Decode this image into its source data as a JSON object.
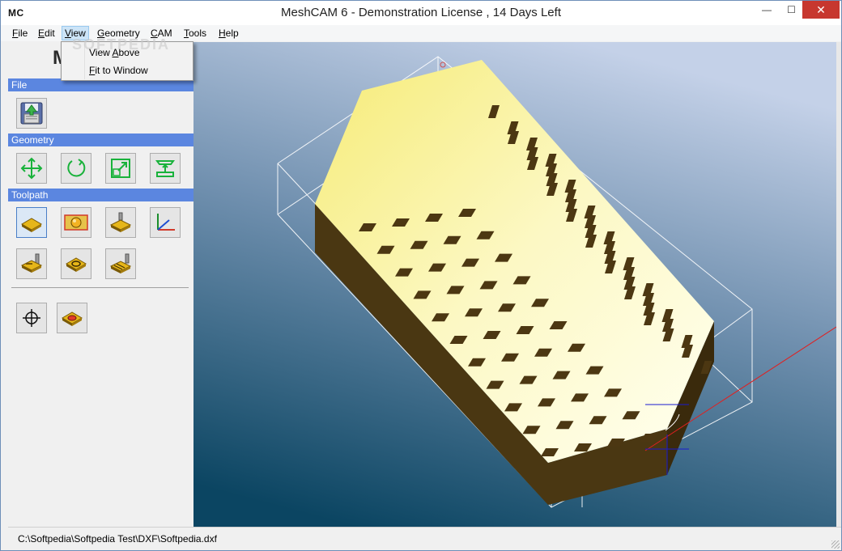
{
  "window": {
    "logo": "MC",
    "title": "MeshCAM 6 - Demonstration License  , 14 Days Left",
    "close_glyph": "✕",
    "min_glyph": "—",
    "max_glyph": "☐"
  },
  "menu": {
    "items": [
      {
        "id": "file",
        "label_u": "F",
        "label_rest": "ile"
      },
      {
        "id": "edit",
        "label_u": "E",
        "label_rest": "dit"
      },
      {
        "id": "view",
        "label_u": "V",
        "label_rest": "iew"
      },
      {
        "id": "geometry",
        "label_u": "G",
        "label_rest": "eometry"
      },
      {
        "id": "cam",
        "label_u": "C",
        "label_rest": "AM"
      },
      {
        "id": "tools",
        "label_u": "T",
        "label_rest": "ools"
      },
      {
        "id": "help",
        "label_u": "H",
        "label_rest": "elp"
      }
    ]
  },
  "view_menu": {
    "items": [
      {
        "pre": "View ",
        "u": "A",
        "post": "bove"
      },
      {
        "pre": "",
        "u": "F",
        "post": "it to Window"
      }
    ]
  },
  "sidebar": {
    "logo": "M",
    "sections": [
      "File",
      "Geometry",
      "Toolpath"
    ]
  },
  "watermark": "SOFTPEDIA",
  "status": {
    "path": "C:\\Softpedia\\Softpedia Test\\DXF\\Softpedia.dxf"
  },
  "colors": {
    "section_header": "#5b86e0",
    "close_button": "#c7372f",
    "part_top": "#fbf6a6",
    "part_side": "#4a3712",
    "viewport_top": "#bccbe3",
    "viewport_bottom": "#0e4562"
  }
}
